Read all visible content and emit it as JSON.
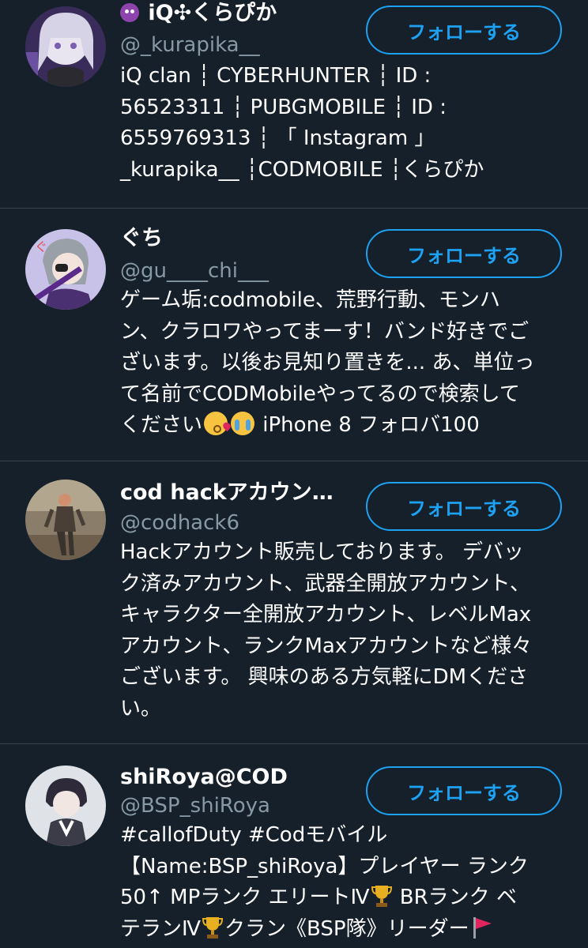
{
  "follow_label": "フォローする",
  "users": [
    {
      "name": "iQ✣くらぴか",
      "name_icon": "smiling-imp-icon",
      "handle": "@_kurapika__",
      "bio": [
        "iQ clan ┆ CYBERHUNTER ┆ ID :",
        "56523311 ┆ PUBGMOBILE ┆ ID :",
        "6559769313 ┆ 「 Instagram 」",
        "_kurapika__ ┆CODMOBILE ┆くらぴか"
      ]
    },
    {
      "name": "ぐち",
      "handle": "@gu____chi___",
      "bio": [
        "ゲーム垢:codmobile、荒野行動、モンハ",
        "ン、クラロワやってまーす！バンド好きでご",
        "ざいます。以後お見知り置きを... あ、単位っ",
        "て名前でCODMobileやってるので検索して",
        "ください",
        " iPhone 8 フォロバ100"
      ]
    },
    {
      "name": "cod hackアカウント…",
      "handle": "@codhack6",
      "bio": [
        "Hackアカウント販売しております。 デバッ",
        "ク済みアカウント、武器全開放アカウント、",
        "キャラクター全開放アカウント、レベルMax",
        "アカウント、ランクMaxアカウントなど様々",
        "ございます。 興味のある方気軽にDMくださ",
        "い。"
      ]
    },
    {
      "name": "shiRoya@COD",
      "handle": "@BSP_shiRoya",
      "bio": [
        "#callofDuty #Codモバイル",
        "【Name:BSP_shiRoya】プレイヤー ランク",
        "50↑ MPランク エリートⅣ",
        " BRランク ベ",
        "テランⅣ",
        "クラン《BSP隊》リーダー"
      ]
    }
  ],
  "colors": {
    "background": "#15202b",
    "accent": "#1da1f2",
    "secondary_text": "#8899a6",
    "divider": "#38444d"
  }
}
